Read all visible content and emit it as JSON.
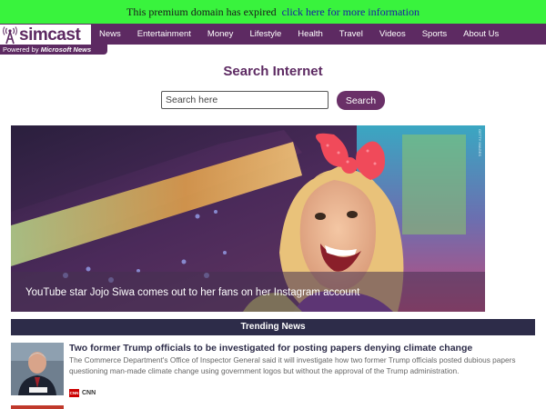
{
  "banner": {
    "text": "This premium domain has expired",
    "link_text": "click here for more information"
  },
  "logo": {
    "name": "simcast",
    "powered_prefix": "Powered by",
    "powered_brand": "Microsoft News"
  },
  "nav": {
    "items": [
      {
        "label": "News"
      },
      {
        "label": "Entertainment"
      },
      {
        "label": "Money"
      },
      {
        "label": "Lifestyle"
      },
      {
        "label": "Health"
      },
      {
        "label": "Travel"
      },
      {
        "label": "Videos"
      },
      {
        "label": "Sports"
      },
      {
        "label": "About Us"
      }
    ]
  },
  "search": {
    "title": "Search Internet",
    "placeholder": "Search here",
    "button_label": "Search"
  },
  "hero": {
    "caption": "YouTube star Jojo Siwa comes out to her fans on her Instagram account",
    "credit": "GETTY IMAGES"
  },
  "trending": {
    "header": "Trending News",
    "articles": [
      {
        "title": "Two former Trump officials to be investigated for posting papers denying climate change",
        "description": "The Commerce Department's Office of Inspector General said it will investigate how two former Trump officials posted dubious papers questioning man-made climate change using government logos but without the approval of the Trump administration.",
        "source_logo": "CNN",
        "source": "CNN"
      }
    ]
  },
  "colors": {
    "brand_purple": "#5d2a62",
    "banner_green": "#39f33d",
    "trending_bg": "#2d2c49",
    "title_navy": "#2d2c49"
  }
}
